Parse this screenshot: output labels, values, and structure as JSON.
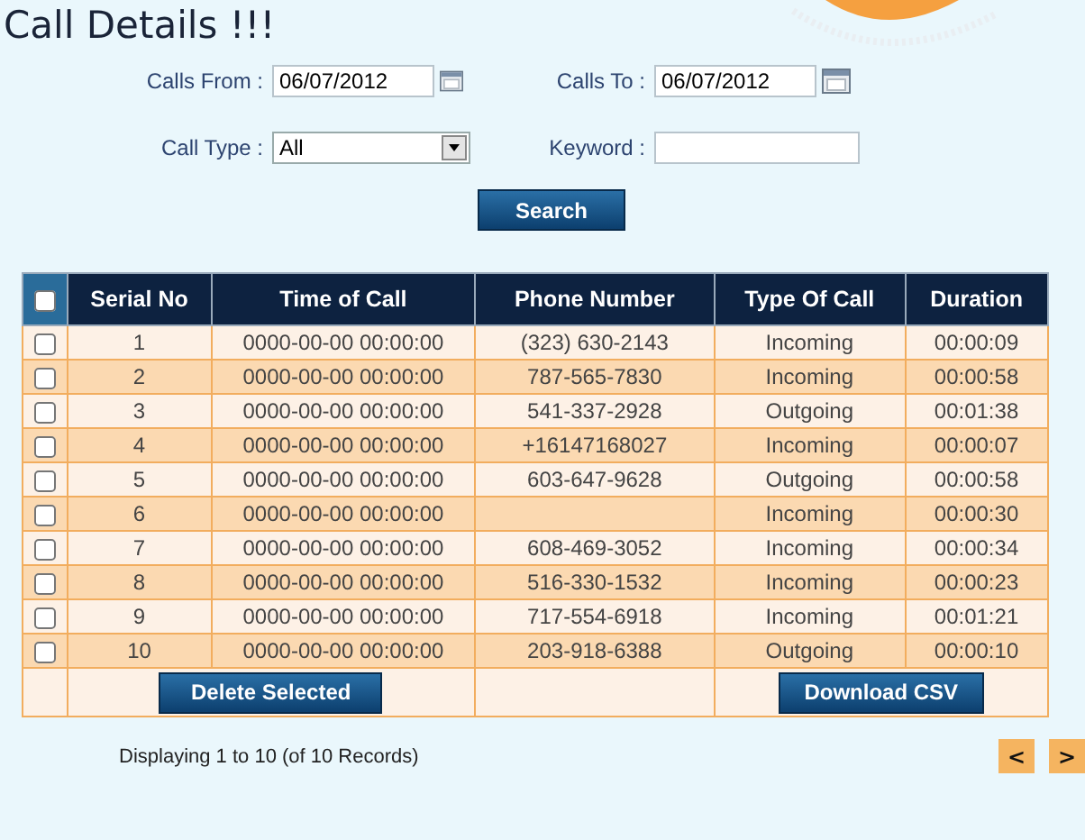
{
  "title": "Call Details !!!",
  "filters": {
    "calls_from": {
      "label": "Calls From :",
      "value": "06/07/2012"
    },
    "calls_to": {
      "label": "Calls To :",
      "value": "06/07/2012"
    },
    "call_type": {
      "label": "Call Type :",
      "value": "All"
    },
    "keyword": {
      "label": "Keyword :"
    },
    "search_button": "Search"
  },
  "table": {
    "select_all": {
      "checked": false
    },
    "columns": [
      "Serial No",
      "Time of Call",
      "Phone Number",
      "Type Of Call",
      "Duration"
    ],
    "rows": [
      {
        "checked": false,
        "cells": [
          "1",
          "0000-00-00 00:00:00",
          "(323) 630-2143",
          "Incoming",
          "00:00:09"
        ]
      },
      {
        "checked": false,
        "cells": [
          "2",
          "0000-00-00 00:00:00",
          "787-565-7830",
          "Incoming",
          "00:00:58"
        ]
      },
      {
        "checked": false,
        "cells": [
          "3",
          "0000-00-00 00:00:00",
          "541-337-2928",
          "Outgoing",
          "00:01:38"
        ]
      },
      {
        "checked": false,
        "cells": [
          "4",
          "0000-00-00 00:00:00",
          "+16147168027",
          "Incoming",
          "00:00:07"
        ]
      },
      {
        "checked": false,
        "cells": [
          "5",
          "0000-00-00 00:00:00",
          "603-647-9628",
          "Outgoing",
          "00:00:58"
        ]
      },
      {
        "checked": false,
        "cells": [
          "6",
          "0000-00-00 00:00:00",
          null,
          "Incoming",
          "00:00:30"
        ]
      },
      {
        "checked": false,
        "cells": [
          "7",
          "0000-00-00 00:00:00",
          "608-469-3052",
          "Incoming",
          "00:00:34"
        ]
      },
      {
        "checked": false,
        "cells": [
          "8",
          "0000-00-00 00:00:00",
          "516-330-1532",
          "Incoming",
          "00:00:23"
        ]
      },
      {
        "checked": false,
        "cells": [
          "9",
          "0000-00-00 00:00:00",
          "717-554-6918",
          "Incoming",
          "00:01:21"
        ]
      },
      {
        "checked": false,
        "cells": [
          "10",
          "0000-00-00 00:00:00",
          "203-918-6388",
          "Outgoing",
          "00:00:10"
        ]
      }
    ],
    "delete_button": "Delete Selected",
    "download_button": "Download CSV"
  },
  "pagination": {
    "summary": "Displaying 1 to 10 (of 10 Records)",
    "prev": "<",
    "next": ">"
  }
}
